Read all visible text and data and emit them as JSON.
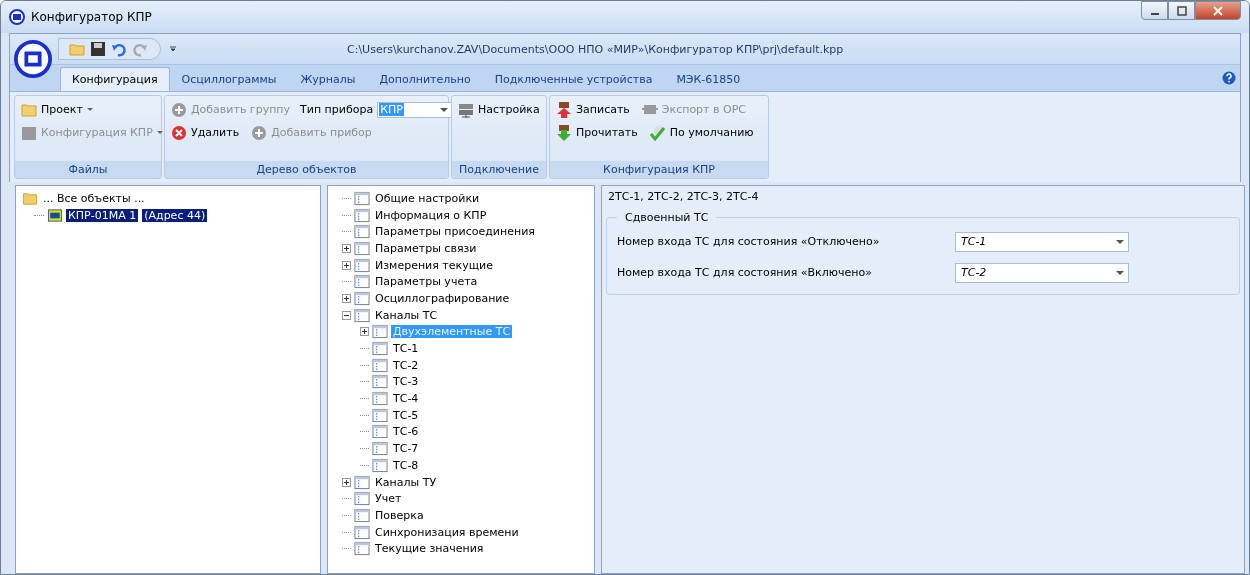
{
  "window": {
    "title": "Конфигуратор КПР"
  },
  "quick_access": {
    "path": "C:\\Users\\kurchanov.ZAV\\Documents\\ООО НПО «МИР»\\Конфигуратор КПР\\prj\\default.kpp"
  },
  "tabs": [
    {
      "label": "Конфигурация",
      "selected": true
    },
    {
      "label": "Осциллограммы",
      "selected": false
    },
    {
      "label": "Журналы",
      "selected": false
    },
    {
      "label": "Дополнительно",
      "selected": false
    },
    {
      "label": "Подключенные устройства",
      "selected": false
    },
    {
      "label": "МЭК-61850",
      "selected": false
    }
  ],
  "ribbon": [
    {
      "title": "Файлы",
      "items": [
        {
          "kind": "dropdown",
          "label": "Проект",
          "disabled": false
        },
        {
          "kind": "dropdown",
          "label": "Конфигурация КПР",
          "disabled": true
        }
      ]
    },
    {
      "title": "Дерево объектов",
      "items": [
        {
          "kind": "button",
          "label": "Добавить группу",
          "disabled": true
        },
        {
          "kind": "combo",
          "label": "Тип прибора",
          "value": "КПР"
        },
        {
          "kind": "button",
          "label": "Удалить",
          "disabled": false
        },
        {
          "kind": "button",
          "label": "Добавить прибор",
          "disabled": true
        }
      ]
    },
    {
      "title": "Подключение",
      "items": [
        {
          "kind": "button",
          "label": "Настройка",
          "disabled": false
        }
      ]
    },
    {
      "title": "Конфигурация КПР",
      "items": [
        {
          "kind": "button",
          "label": "Записать",
          "disabled": false
        },
        {
          "kind": "button",
          "label": "Экспорт в OPC",
          "disabled": true
        },
        {
          "kind": "button",
          "label": "Прочитать",
          "disabled": false
        },
        {
          "kind": "button",
          "label": "По умолчанию",
          "disabled": false
        }
      ]
    }
  ],
  "object_tree": {
    "root": "... Все объекты ...",
    "children": [
      {
        "label": "КПР-01МА 1",
        "address": "(Адрес 44)",
        "selected": true
      }
    ]
  },
  "settings_tree": [
    {
      "label": "Общие настройки",
      "selected": false
    },
    {
      "label": "Информация о КПР",
      "selected": false
    },
    {
      "label": "Параметры присоединения",
      "selected": false
    },
    {
      "label": "Параметры связи",
      "expanded": false,
      "selected": false
    },
    {
      "label": "Измерения текущие",
      "expanded": false,
      "selected": false
    },
    {
      "label": "Параметры учета",
      "selected": false
    },
    {
      "label": "Осциллографирование",
      "expanded": false,
      "selected": false
    },
    {
      "label": "Каналы ТС",
      "expanded": true,
      "selected": false,
      "children": [
        {
          "label": "Двухэлементные ТС",
          "expanded": false,
          "selected": true
        },
        {
          "label": "ТС-1",
          "selected": false
        },
        {
          "label": "ТС-2",
          "selected": false
        },
        {
          "label": "ТС-3",
          "selected": false
        },
        {
          "label": "ТС-4",
          "selected": false
        },
        {
          "label": "ТС-5",
          "selected": false
        },
        {
          "label": "ТС-6",
          "selected": false
        },
        {
          "label": "ТС-7",
          "selected": false
        },
        {
          "label": "ТС-8",
          "selected": false
        }
      ]
    },
    {
      "label": "Каналы ТУ",
      "expanded": false,
      "selected": false
    },
    {
      "label": "Учет",
      "selected": false
    },
    {
      "label": "Поверка",
      "selected": false
    },
    {
      "label": "Синхронизация времени",
      "selected": false
    },
    {
      "label": "Текущие значения",
      "selected": false
    }
  ],
  "details": {
    "heading": "2ТС-1, 2ТС-2, 2ТС-3, 2ТС-4",
    "group": "Сдвоенный ТС",
    "fields": [
      {
        "label": "Номер входа ТС для состояния «Отключено»",
        "value": "ТС-1"
      },
      {
        "label": "Номер входа ТС для состояния «Включено»",
        "value": "ТС-2"
      }
    ]
  }
}
